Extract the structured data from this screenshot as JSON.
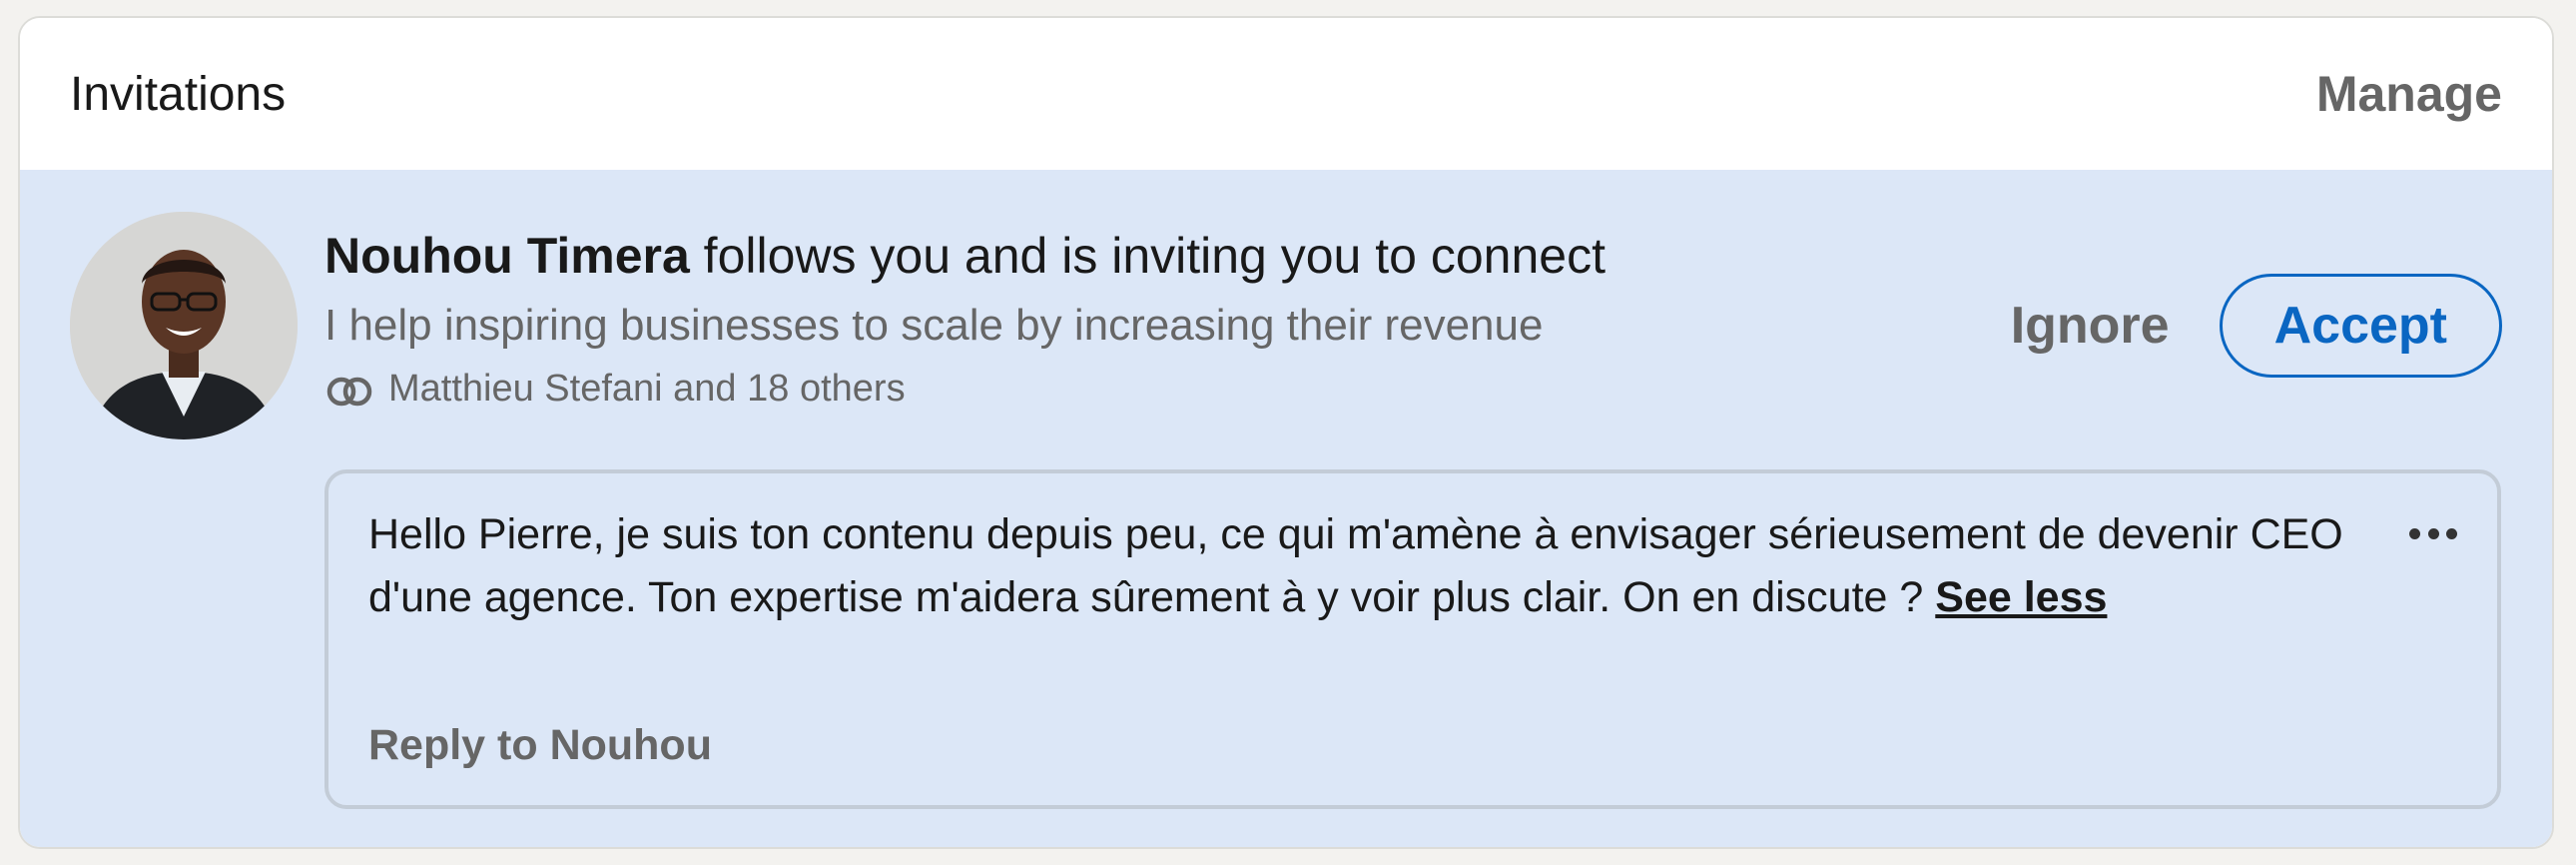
{
  "header": {
    "title": "Invitations",
    "manage_label": "Manage"
  },
  "invitation": {
    "sender_name": "Nouhou Timera",
    "action_text": " follows you and is inviting you to connect",
    "headline": "I help inspiring businesses to scale by increasing their revenue",
    "mutual_connections": "Matthieu Stefani and 18 others",
    "ignore_label": "Ignore",
    "accept_label": "Accept",
    "message": "Hello Pierre, je suis ton contenu depuis peu, ce qui m'amène à envisager sérieusement de devenir CEO d'une agence. Ton expertise m'aidera sûrement à y voir plus clair. On en discute ? ",
    "see_less_label": "See less",
    "reply_label": "Reply to Nouhou"
  },
  "icons": {
    "avatar": "profile-photo",
    "mutual": "mutual-connections-icon",
    "more": "more-options-icon"
  },
  "colors": {
    "accent": "#0a66c2",
    "invite_background": "#dce7f7",
    "muted_text": "#666666"
  }
}
